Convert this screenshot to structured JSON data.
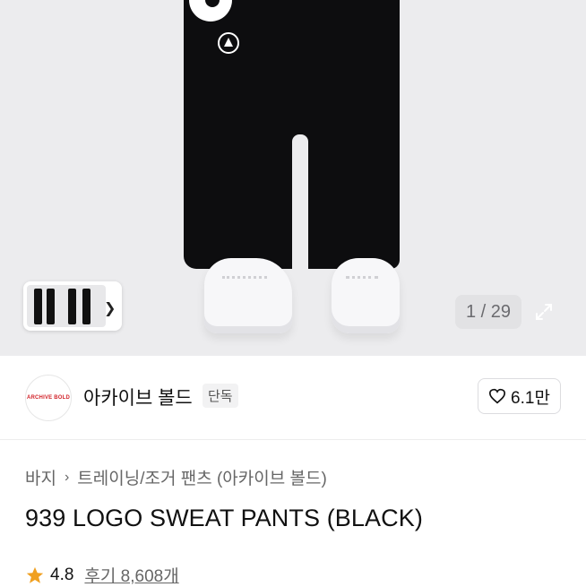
{
  "gallery": {
    "counter": "1 / 29",
    "accent_shoe": "#f7f7f9",
    "pants_color": "#0d0d0f"
  },
  "brand": {
    "logo_text": "ARCHIVE BOLD",
    "name": "아카이브 볼드",
    "badge": "단독",
    "likes": "6.1만"
  },
  "breadcrumb": {
    "category": "바지",
    "subcategory": "트레이닝/조거 팬츠 (아카이브 볼드)"
  },
  "product": {
    "title": "939 LOGO SWEAT PANTS (BLACK)",
    "rating": "4.8",
    "reviews": "후기 8,608개",
    "star_color": "#f0a020"
  },
  "icons": [
    "logo-badge-icon",
    "chevron-right-icon",
    "expand-icon",
    "heart-icon",
    "star-icon"
  ]
}
